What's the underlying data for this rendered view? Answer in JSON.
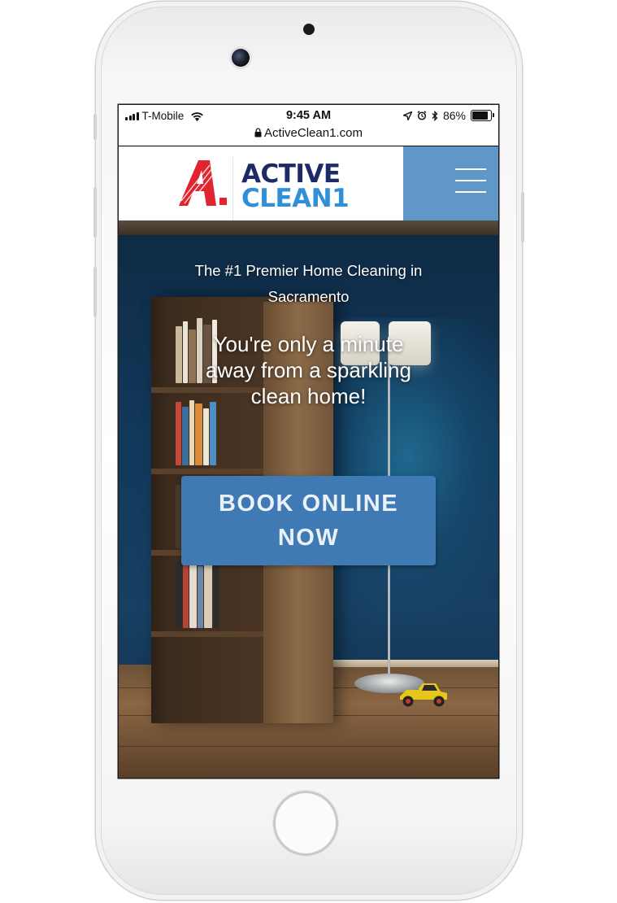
{
  "status_bar": {
    "carrier": "T-Mobile",
    "time": "9:45 AM",
    "battery": "86%",
    "battery_level": 0.86
  },
  "browser": {
    "url": "ActiveClean1.com"
  },
  "header": {
    "logo_line1": "ACTIVE",
    "logo_line2": "CLEAN1",
    "colors": {
      "logo_red": "#e0252f",
      "logo_navy": "#1c2a66",
      "logo_blue": "#2f8fd8",
      "menu_bg": "#5f98c8"
    }
  },
  "hero": {
    "subtitle": "The #1 Premier Home Cleaning in Sacramento",
    "headline": "You're only a minute away from a sparkling clean home!",
    "cta_label": "BOOK ONLINE NOW",
    "cta_color": "#3f7ab5"
  },
  "icons": [
    "signal-icon",
    "wifi-icon",
    "lock-icon",
    "location-icon",
    "alarm-icon",
    "bluetooth-icon",
    "battery-icon",
    "hamburger-menu-icon"
  ]
}
